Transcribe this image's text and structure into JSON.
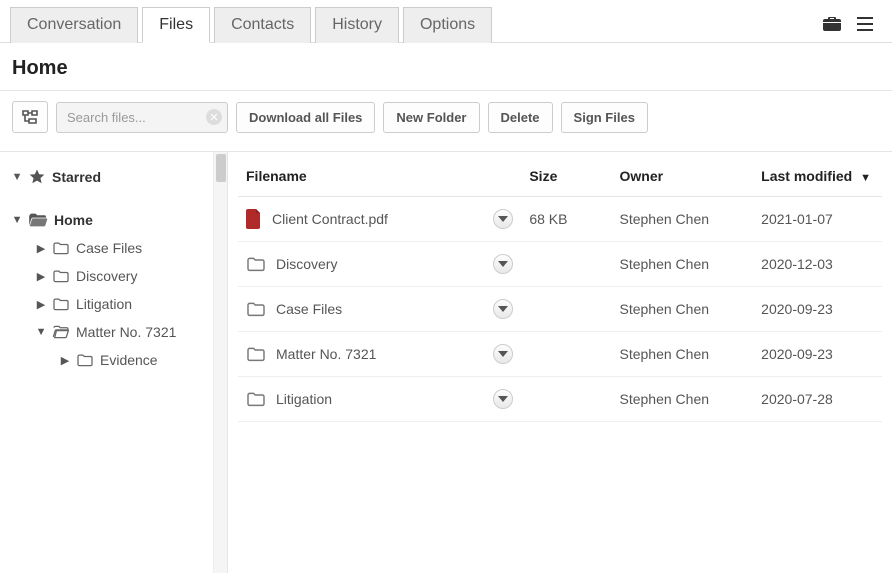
{
  "tabs": {
    "items": [
      {
        "label": "Conversation",
        "active": false
      },
      {
        "label": "Files",
        "active": true
      },
      {
        "label": "Contacts",
        "active": false
      },
      {
        "label": "History",
        "active": false
      },
      {
        "label": "Options",
        "active": false
      }
    ]
  },
  "heading": "Home",
  "toolbar": {
    "search_placeholder": "Search files...",
    "download_all": "Download all Files",
    "new_folder": "New Folder",
    "delete": "Delete",
    "sign_files": "Sign Files"
  },
  "tree": {
    "starred": "Starred",
    "home": "Home",
    "case_files": "Case Files",
    "discovery": "Discovery",
    "litigation": "Litigation",
    "matter": "Matter No. 7321",
    "evidence": "Evidence"
  },
  "table": {
    "headers": {
      "filename": "Filename",
      "size": "Size",
      "owner": "Owner",
      "last_modified": "Last modified"
    },
    "sort_indicator": "▼",
    "rows": [
      {
        "name": "Client Contract.pdf",
        "type": "pdf",
        "size": "68 KB",
        "owner": "Stephen Chen",
        "modified": "2021-01-07"
      },
      {
        "name": "Discovery",
        "type": "folder",
        "size": "",
        "owner": "Stephen Chen",
        "modified": "2020-12-03"
      },
      {
        "name": "Case Files",
        "type": "folder",
        "size": "",
        "owner": "Stephen Chen",
        "modified": "2020-09-23"
      },
      {
        "name": "Matter No. 7321",
        "type": "folder",
        "size": "",
        "owner": "Stephen Chen",
        "modified": "2020-09-23"
      },
      {
        "name": "Litigation",
        "type": "folder",
        "size": "",
        "owner": "Stephen Chen",
        "modified": "2020-07-28"
      }
    ]
  }
}
